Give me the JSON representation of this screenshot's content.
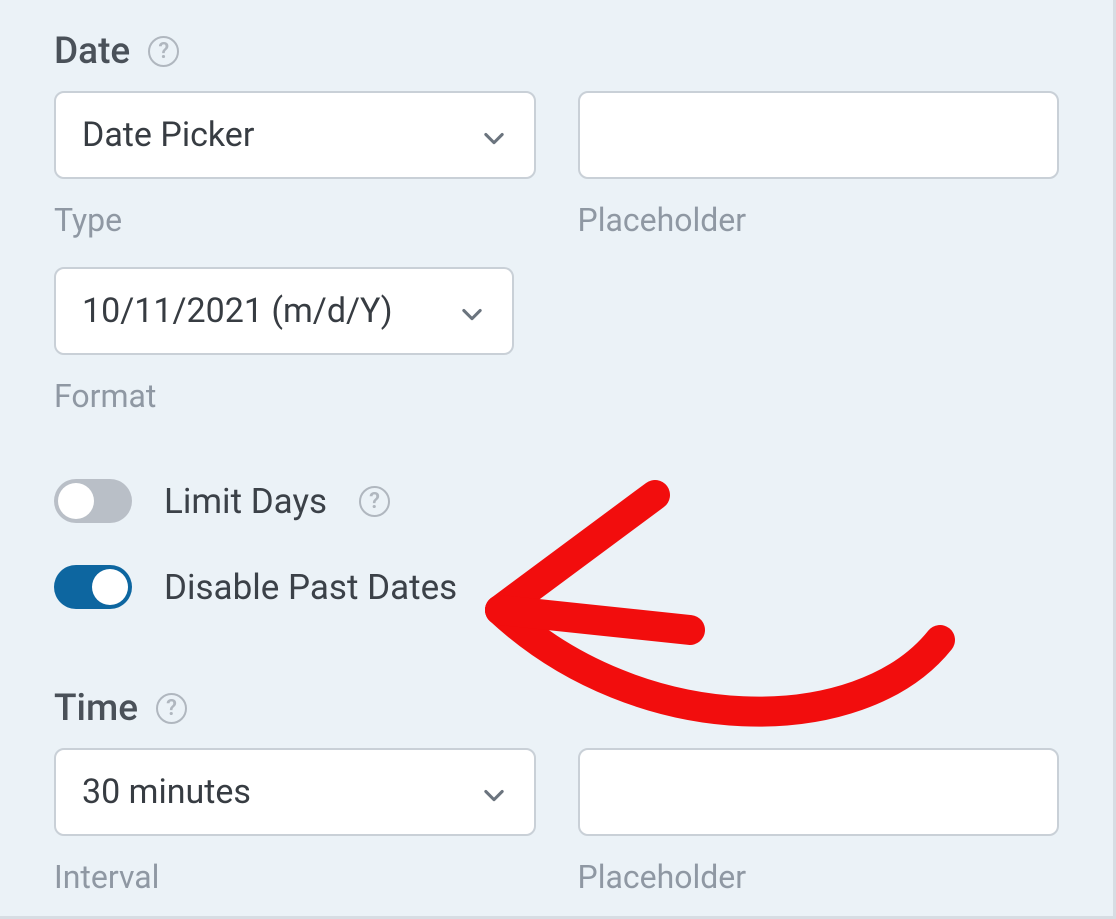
{
  "date": {
    "heading": "Date",
    "type_value": "Date Picker",
    "type_label": "Type",
    "placeholder_value": "",
    "placeholder_label": "Placeholder",
    "format_value": "10/11/2021 (m/d/Y)",
    "format_label": "Format"
  },
  "toggles": {
    "limit_days": {
      "label": "Limit Days",
      "on": false
    },
    "disable_past_dates": {
      "label": "Disable Past Dates",
      "on": true
    }
  },
  "time": {
    "heading": "Time",
    "interval_value": "30 minutes",
    "interval_label": "Interval",
    "placeholder_value": "",
    "placeholder_label": "Placeholder"
  },
  "colors": {
    "accent": "#0d66a0",
    "annotation": "#f20d0d"
  }
}
